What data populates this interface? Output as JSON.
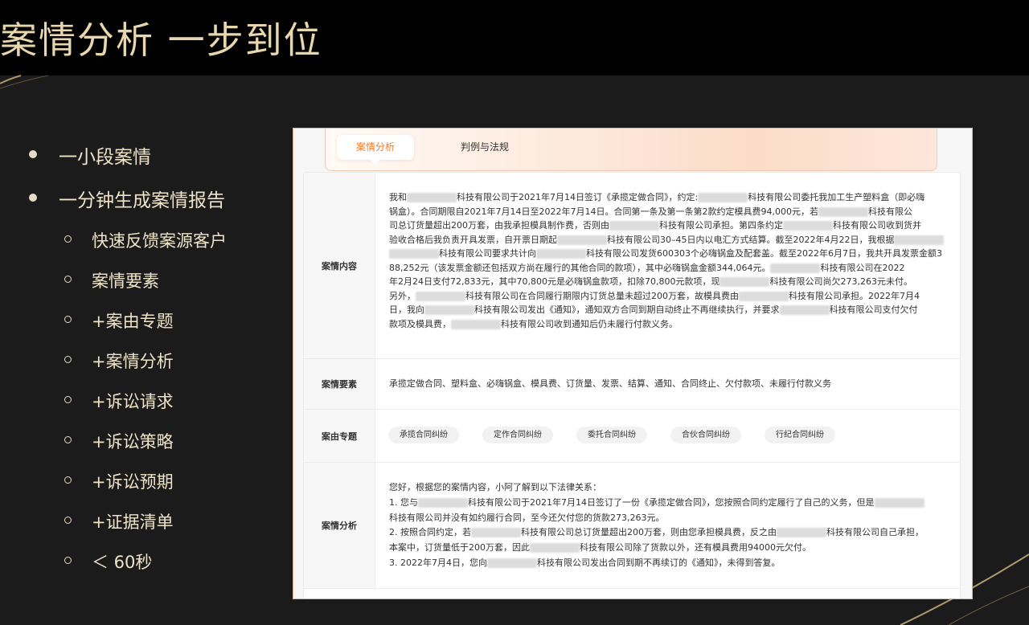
{
  "title": "案情分析 一步到位",
  "bullets": {
    "level1": [
      "一小段案情",
      "一分钟生成案情报告"
    ],
    "level2": [
      "快速反馈案源客户",
      "案情要素",
      "+案由专题",
      "+案情分析",
      "+诉讼请求",
      "+诉讼策略",
      "+诉讼预期",
      "+证据清单",
      "＜ 60秒"
    ]
  },
  "tabs": [
    "案情分析",
    "判例与法规"
  ],
  "rows": {
    "content_label": "案情内容",
    "content_lines": [
      [
        "我和",
        "",
        "科技有限公司于2021年7月14日签订《承揽定做合同》，约定:",
        "",
        "科技有限公司委托我加工生产塑料盒（即必嗨"
      ],
      [
        "锅盒）。合同期限自2021年7月14日至2022年7月14日。合同第一条及第一条第2款约定模具费94,000元，若",
        "",
        "科技有限公"
      ],
      [
        "司总订货量超出200万套，由我承担模具制作费，否则由",
        "",
        "科技有限公司承担。第四条约定",
        "",
        "科技有限公司收到货并"
      ],
      [
        "验收合格后我负责开具发票，自开票日期起",
        "",
        "科技有限公司30–45日内以电汇方式结算。截至2022年4月22日，我根据",
        ""
      ],
      [
        "",
        "科技有限公司要求共计向",
        "",
        "科技有限公司发货600303个必嗨锅盒及配套盖。截至2022年6月7日，我共开具发票金额3"
      ],
      [
        "88,252元（该发票金额还包括双方尚在履行的其他合同的款项），其中必嗨锅盒金额344,064元。",
        "",
        "科技有限公司在2022"
      ],
      [
        "年2月24日支付72,833元，其中70,800元是必嗨锅盒款项，扣除70,800元款项，现",
        "",
        "科技有限公司尚欠273,263元未付。"
      ],
      [
        "另外，",
        "",
        "科技有限公司在合同履行期限内订货总量未超过200万套，故模具费由",
        "",
        "科技有限公司承担。2022年7月4"
      ],
      [
        "日，我向",
        "",
        "科技有限公司发出《通知》，通知双方合同到期自动终止不再继续执行，并要求",
        "",
        "科技有限公司支付欠付"
      ],
      [
        "款项及模具费，",
        "",
        "科技有限公司收到通知后仍未履行付款义务。"
      ]
    ],
    "elements_label": "案情要素",
    "elements_text": "承揽定做合同、塑料盒、必嗨锅盒、模具费、订货量、发票、结算、通知、合同终止、欠付款项、未履行付款义务",
    "topics_label": "案由专题",
    "topics": [
      "承揽合同纠纷",
      "定作合同纠纷",
      "委托合同纠纷",
      "合伙合同纠纷",
      "行纪合同纠纷"
    ],
    "analysis_label": "案情分析",
    "analysis_lines": [
      [
        "您好，根据您的案情内容，小阿了解到以下法律关系："
      ],
      [
        "1. 您与",
        "",
        "科技有限公司于2021年7月14日签订了一份《承揽定做合同》，您按照合同约定履行了自己的义务，但是",
        ""
      ],
      [
        "科技有限公司并没有如约履行合同，至今还欠付您的货款273,263元。"
      ],
      [
        "2. 按照合同约定，若",
        "",
        "科技有限公司总订货量超出200万套，则由您承担模具费，反之由",
        "",
        "科技有限公司自己承担，"
      ],
      [
        "本案中，订货量低于200万套，因此",
        "",
        "科技有限公司除了货款以外，还有模具费用94000元欠付。"
      ],
      [
        "3. 2022年7月4日，您向",
        "",
        "科技有限公司发出合同到期不再续订的《通知》，未得到答复。"
      ]
    ]
  }
}
